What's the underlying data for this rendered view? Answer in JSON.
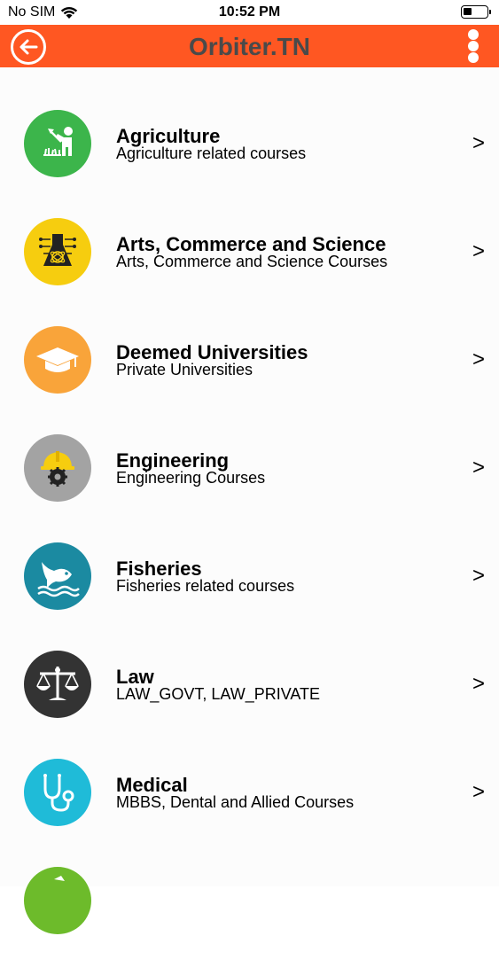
{
  "status_bar": {
    "carrier": "No SIM",
    "time": "10:52 PM"
  },
  "header": {
    "title": "Orbiter.TN",
    "accent_color": "#ff5722"
  },
  "categories": [
    {
      "title": "Agriculture",
      "subtitle": "Agriculture related courses",
      "icon": "farmer-icon",
      "color": "#3cb54b"
    },
    {
      "title": "Arts, Commerce and Science",
      "subtitle": "Arts, Commerce and Science Courses",
      "icon": "flask-atom-icon",
      "color": "#f6cd0f"
    },
    {
      "title": "Deemed Universities",
      "subtitle": "Private Universities",
      "icon": "graduation-cap-icon",
      "color": "#f9a43a"
    },
    {
      "title": "Engineering",
      "subtitle": "Engineering Courses",
      "icon": "hardhat-gear-icon",
      "color": "#a3a3a3"
    },
    {
      "title": "Fisheries",
      "subtitle": "Fisheries related courses",
      "icon": "fish-wave-icon",
      "color": "#1b8aa1"
    },
    {
      "title": "Law",
      "subtitle": "LAW_GOVT, LAW_PRIVATE",
      "icon": "scales-icon",
      "color": "#333333"
    },
    {
      "title": "Medical",
      "subtitle": "MBBS, Dental and Allied Courses",
      "icon": "stethoscope-icon",
      "color": "#1fbbd8"
    },
    {
      "title": "",
      "subtitle": "",
      "icon": "partial-icon",
      "color": "#6dbb2b"
    }
  ],
  "chevron": ">"
}
